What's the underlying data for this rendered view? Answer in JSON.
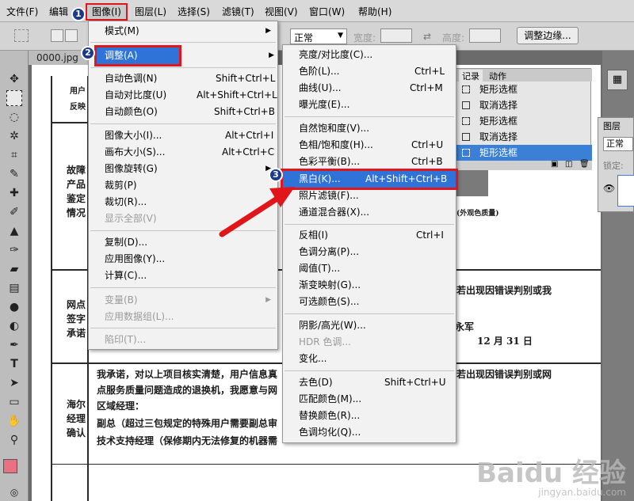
{
  "menubar": {
    "items": [
      "文件(F)",
      "编辑",
      "图像(I)",
      "图层(L)",
      "选择(S)",
      "滤镜(T)",
      "视图(V)",
      "窗口(W)",
      "帮助(H)"
    ]
  },
  "options": {
    "mode": "正常",
    "width_label": "宽度:",
    "height_label": "高度:",
    "refine_button": "调整边缘..."
  },
  "document": {
    "tab": "0000.jpg",
    "rows": [
      {
        "label": [
          "用户",
          "反映"
        ]
      },
      {
        "label": [
          "故障",
          "产品",
          "鉴定",
          "情况"
        ]
      },
      {
        "label": [
          "网点",
          "签字",
          "承诺"
        ]
      },
      {
        "label": [
          "海尔",
          "经理",
          "确认"
        ]
      }
    ],
    "lines": [
      "我承诺，对以上项目核实清楚，用户信息真",
      "点服务质量问题造成的退换机，我愿意与网",
      "区域经理：",
      "副总（超过三包规定的特殊用户需要副总审",
      "技术支持经理（保修期内无法修复的机器需"
    ],
    "right_texts": [
      "若出现因错误判别或我",
      "永军",
      "12 月 31 日",
      "若出现因错误判别或网",
      "(外观色质量)"
    ]
  },
  "history": {
    "tabs": [
      "记录",
      "动作"
    ],
    "items": [
      "矩形选框",
      "取消选择",
      "矩形选框",
      "取消选择",
      "矩形选框"
    ]
  },
  "layers": {
    "tab": "图层",
    "mode": "正常",
    "lock": "锁定:"
  },
  "image_menu": {
    "items": [
      {
        "label": "模式(M)",
        "shortcut": "",
        "submenu": true,
        "disabled": false
      },
      {
        "label": "调整(A)",
        "shortcut": "",
        "submenu": true,
        "disabled": false
      },
      {
        "label": "自动色调(N)",
        "shortcut": "Shift+Ctrl+L",
        "disabled": false
      },
      {
        "label": "自动对比度(U)",
        "shortcut": "Alt+Shift+Ctrl+L",
        "disabled": false
      },
      {
        "label": "自动颜色(O)",
        "shortcut": "Shift+Ctrl+B",
        "disabled": false
      },
      {
        "label": "图像大小(I)...",
        "shortcut": "Alt+Ctrl+I",
        "disabled": false
      },
      {
        "label": "画布大小(S)...",
        "shortcut": "Alt+Ctrl+C",
        "disabled": false
      },
      {
        "label": "图像旋转(G)",
        "shortcut": "",
        "submenu": true,
        "disabled": false
      },
      {
        "label": "裁剪(P)",
        "shortcut": "",
        "disabled": false
      },
      {
        "label": "裁切(R)...",
        "shortcut": "",
        "disabled": false
      },
      {
        "label": "显示全部(V)",
        "shortcut": "",
        "disabled": true
      },
      {
        "label": "复制(D)...",
        "shortcut": "",
        "disabled": false
      },
      {
        "label": "应用图像(Y)...",
        "shortcut": "",
        "disabled": false
      },
      {
        "label": "计算(C)...",
        "shortcut": "",
        "disabled": false
      },
      {
        "label": "变量(B)",
        "shortcut": "",
        "submenu": true,
        "disabled": true
      },
      {
        "label": "应用数据组(L)...",
        "shortcut": "",
        "disabled": true
      },
      {
        "label": "陷印(T)...",
        "shortcut": "",
        "disabled": true
      }
    ]
  },
  "adjust_menu": {
    "items": [
      {
        "label": "亮度/对比度(C)...",
        "shortcut": "",
        "disabled": false
      },
      {
        "label": "色阶(L)...",
        "shortcut": "Ctrl+L",
        "disabled": false
      },
      {
        "label": "曲线(U)...",
        "shortcut": "Ctrl+M",
        "disabled": false
      },
      {
        "label": "曝光度(E)...",
        "shortcut": "",
        "disabled": false
      },
      {
        "label": "自然饱和度(V)...",
        "shortcut": "",
        "disabled": false
      },
      {
        "label": "色相/饱和度(H)...",
        "shortcut": "Ctrl+U",
        "disabled": false
      },
      {
        "label": "色彩平衡(B)...",
        "shortcut": "Ctrl+B",
        "disabled": false
      },
      {
        "label": "黑白(K)...",
        "shortcut": "Alt+Shift+Ctrl+B",
        "disabled": false
      },
      {
        "label": "照片滤镜(F)...",
        "shortcut": "",
        "disabled": false
      },
      {
        "label": "通道混合器(X)...",
        "shortcut": "",
        "disabled": false
      },
      {
        "label": "反相(I)",
        "shortcut": "Ctrl+I",
        "disabled": false
      },
      {
        "label": "色调分离(P)...",
        "shortcut": "",
        "disabled": false
      },
      {
        "label": "阈值(T)...",
        "shortcut": "",
        "disabled": false
      },
      {
        "label": "渐变映射(G)...",
        "shortcut": "",
        "disabled": false
      },
      {
        "label": "可选颜色(S)...",
        "shortcut": "",
        "disabled": false
      },
      {
        "label": "阴影/高光(W)...",
        "shortcut": "",
        "disabled": false
      },
      {
        "label": "HDR 色调...",
        "shortcut": "",
        "disabled": true
      },
      {
        "label": "变化...",
        "shortcut": "",
        "disabled": false
      },
      {
        "label": "去色(D)",
        "shortcut": "Shift+Ctrl+U",
        "disabled": false
      },
      {
        "label": "匹配颜色(M)...",
        "shortcut": "",
        "disabled": false
      },
      {
        "label": "替换颜色(R)...",
        "shortcut": "",
        "disabled": false
      },
      {
        "label": "色调均化(Q)...",
        "shortcut": "",
        "disabled": false
      }
    ]
  },
  "steps": [
    "1",
    "2",
    "3"
  ],
  "watermark": {
    "brand": "Baidu 经验",
    "url": "jingyan.baidu.com"
  },
  "colors": {
    "highlight": "#2f73d8",
    "annotation": "#e0161b",
    "badge": "#1a3a8a"
  }
}
